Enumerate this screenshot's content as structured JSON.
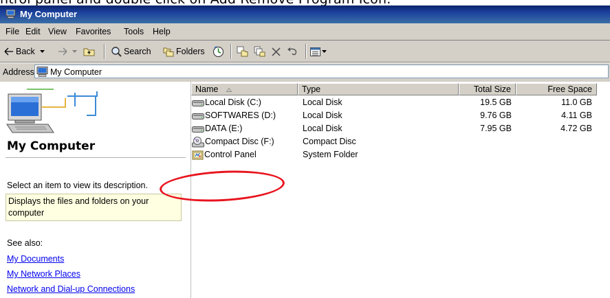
{
  "caption": "ntrol panel and double click on Add Remove Program Icon.",
  "window": {
    "title": "My Computer"
  },
  "menu": [
    "File",
    "Edit",
    "View",
    "Favorites",
    "Tools",
    "Help"
  ],
  "toolbar": {
    "back": "Back",
    "search": "Search",
    "folders": "Folders"
  },
  "address": {
    "label": "Address",
    "value": "My Computer"
  },
  "left_pane": {
    "title": "My Computer",
    "hint": "Select an item to view its description.",
    "info_box": [
      "Displays the files and folders on your",
      "computer"
    ],
    "see_also": "See also:",
    "links": [
      "My Documents",
      "My Network Places",
      "Network and Dial-up Connections"
    ]
  },
  "list": {
    "columns": [
      "Name",
      "Type",
      "Total Size",
      "Free Space"
    ],
    "rows": [
      {
        "icon": "hard-drive-icon",
        "name": "Local Disk (C:)",
        "type": "Local Disk",
        "total": "19.5 GB",
        "free": "11.0 GB"
      },
      {
        "icon": "hard-drive-icon",
        "name": "SOFTWARES (D:)",
        "type": "Local Disk",
        "total": "9.76 GB",
        "free": "4.11 GB"
      },
      {
        "icon": "hard-drive-icon",
        "name": "DATA (E:)",
        "type": "Local Disk",
        "total": "7.95 GB",
        "free": "4.72 GB"
      },
      {
        "icon": "cd-drive-icon",
        "name": "Compact Disc (F:)",
        "type": "Compact Disc",
        "total": "",
        "free": ""
      },
      {
        "icon": "control-panel-icon",
        "name": "Control Panel",
        "type": "System Folder",
        "total": "",
        "free": ""
      }
    ]
  },
  "colors": {
    "titlebar": "#0a246a",
    "link": "#0000ee",
    "highlight_oval": "#e8141e",
    "info_box": "#ffffe1"
  }
}
